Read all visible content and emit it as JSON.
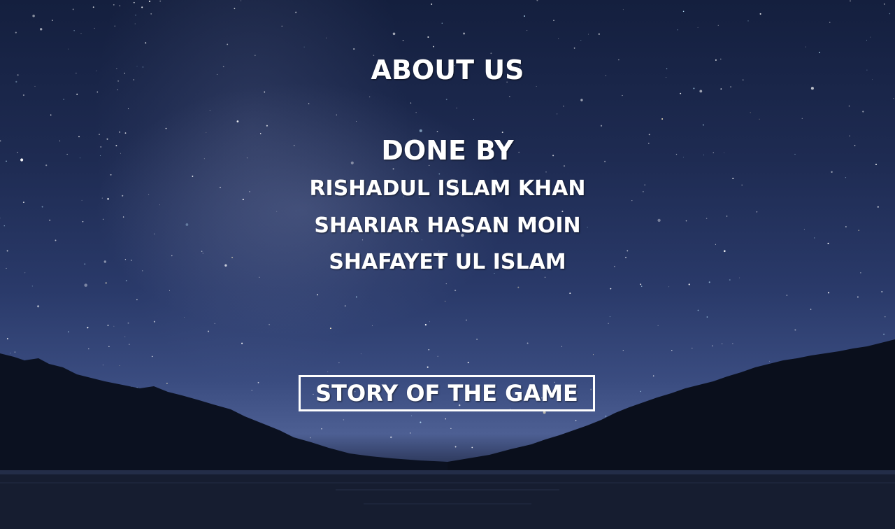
{
  "about": {
    "title": "ABOUT US",
    "done_by_label": "DONE BY",
    "members": [
      "RISHADUL ISLAM KHAN",
      "SHARIAR HASAN MOIN",
      "SHAFAYET UL ISLAM"
    ]
  },
  "story_button": {
    "label": "STORY OF THE GAME"
  },
  "colors": {
    "text": "#ffffff",
    "sky_top": "#141f3e",
    "sky_horizon": "#4d5f93",
    "treeline": "#0a0f1c"
  }
}
